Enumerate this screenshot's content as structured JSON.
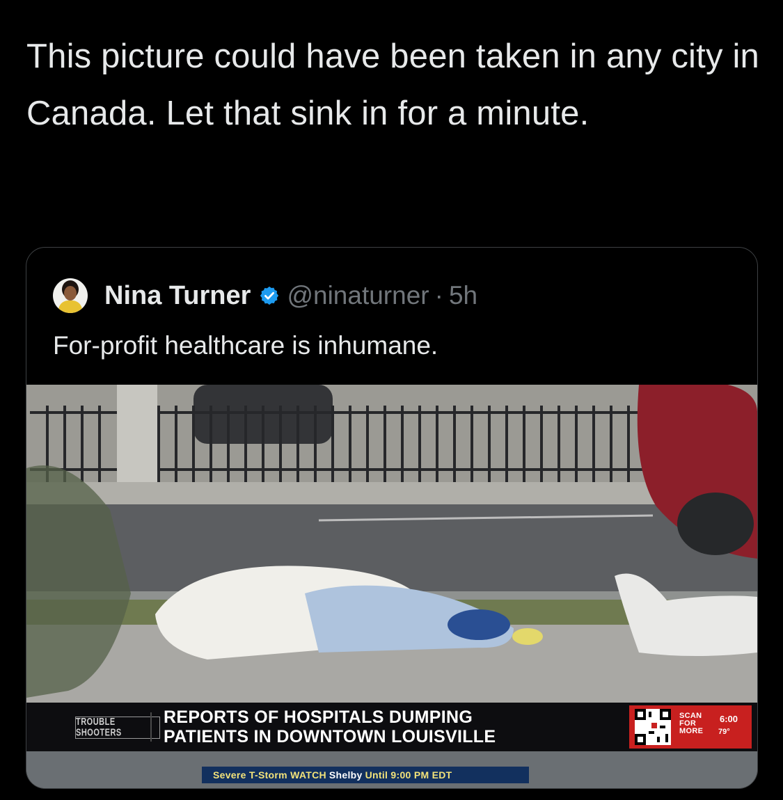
{
  "tweet": {
    "text": "This picture could have been taken in any city in Canada. Let that sink in for a minute."
  },
  "quoted": {
    "name": "Nina Turner",
    "handle": "@ninaturner",
    "separator": "·",
    "time": "5h",
    "text": "For-profit healthcare is inhumane."
  },
  "news": {
    "show_logo": "TROUBLE SHOOTERS",
    "headline_line1": "REPORTS OF HOSPITALS DUMPING",
    "headline_line2": "PATIENTS IN DOWNTOWN LOUISVILLE",
    "scan_line1": "SCAN",
    "scan_line2": "FOR",
    "scan_line3": "MORE",
    "clock": "6:00",
    "temperature": "79°",
    "ticker_part1": "Severe T-Storm WATCH",
    "ticker_part2": "Shelby",
    "ticker_part3": "Until 9:00 PM EDT"
  },
  "colors": {
    "background": "#000000",
    "text_primary": "#e7e9ea",
    "text_secondary": "#71767b",
    "border": "#3e4144",
    "verified": "#1d9bf0",
    "news_red": "#c8201f"
  }
}
